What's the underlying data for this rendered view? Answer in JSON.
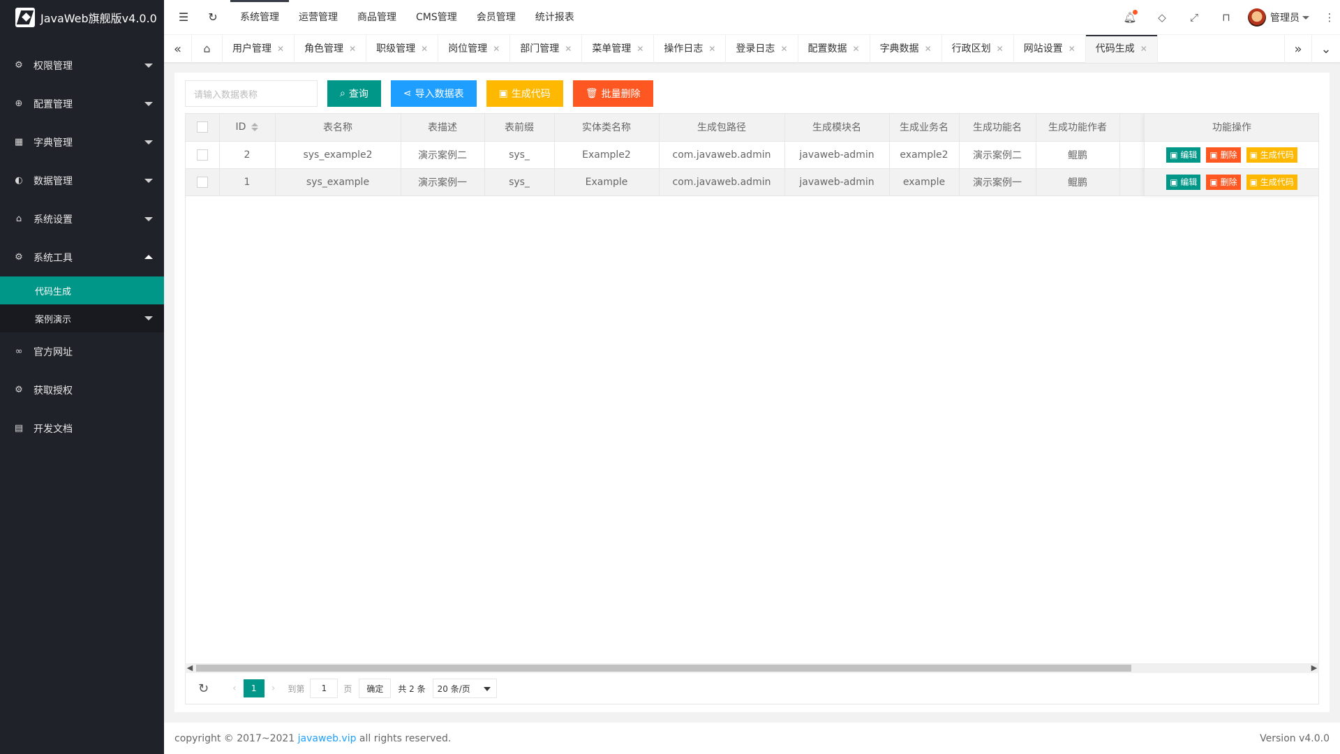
{
  "app": {
    "title": "JavaWeb旗舰版v4.0.0"
  },
  "sidebar": {
    "items": [
      {
        "label": "权限管理",
        "icon": "gear-icon",
        "glyph": "⚙"
      },
      {
        "label": "配置管理",
        "icon": "globe-icon",
        "glyph": "⊕"
      },
      {
        "label": "字典管理",
        "icon": "grid-icon",
        "glyph": "▦"
      },
      {
        "label": "数据管理",
        "icon": "palette-icon",
        "glyph": "◐"
      },
      {
        "label": "系统设置",
        "icon": "home-icon",
        "glyph": "⌂"
      },
      {
        "label": "系统工具",
        "icon": "gear-icon",
        "glyph": "⚙"
      }
    ],
    "submenu": [
      {
        "label": "代码生成"
      },
      {
        "label": "案例演示"
      }
    ],
    "bottom_items": [
      {
        "label": "官方网址",
        "icon": "link-icon",
        "glyph": "∞"
      },
      {
        "label": "获取授权",
        "icon": "gear-icon",
        "glyph": "⚙"
      },
      {
        "label": "开发文档",
        "icon": "book-icon",
        "glyph": "▤"
      }
    ]
  },
  "header": {
    "nav": [
      "系统管理",
      "运营管理",
      "商品管理",
      "CMS管理",
      "会员管理",
      "统计报表"
    ],
    "user": "管理员"
  },
  "tabs": [
    "用户管理",
    "角色管理",
    "职级管理",
    "岗位管理",
    "部门管理",
    "菜单管理",
    "操作日志",
    "登录日志",
    "配置数据",
    "字典数据",
    "行政区划",
    "网站设置",
    "代码生成"
  ],
  "toolbar": {
    "search_placeholder": "请输入数据表称",
    "query": "查询",
    "import": "导入数据表",
    "generate": "生成代码",
    "batch_delete": "批量删除"
  },
  "table": {
    "headers": [
      "ID",
      "表名称",
      "表描述",
      "表前缀",
      "实体类名称",
      "生成包路径",
      "生成模块名",
      "生成业务名",
      "生成功能名",
      "生成功能作者"
    ],
    "ops_header": "功能操作",
    "rows": [
      [
        "2",
        "sys_example2",
        "演示案例二",
        "sys_",
        "Example2",
        "com.javaweb.admin",
        "javaweb-admin",
        "example2",
        "演示案例二",
        "鲲鹏"
      ],
      [
        "1",
        "sys_example",
        "演示案例一",
        "sys_",
        "Example",
        "com.javaweb.admin",
        "javaweb-admin",
        "example",
        "演示案例一",
        "鲲鹏"
      ]
    ],
    "ops": {
      "edit": "编辑",
      "delete": "删除",
      "generate": "生成代码"
    }
  },
  "pager": {
    "current": "1",
    "goto_label": "到第",
    "page_value": "1",
    "page_unit": "页",
    "confirm": "确定",
    "total": "共 2 条",
    "page_size": "20 条/页"
  },
  "footer": {
    "copyright_prefix": "copyright © 2017~2021 ",
    "link": "javaweb.vip",
    "copyright_suffix": " all rights reserved.",
    "version": "Version v4.0.0"
  },
  "colors": {
    "primary": "#009688",
    "blue": "#1e9fff",
    "warm": "#ffb800",
    "danger": "#ff5722",
    "sidebar": "#20222a"
  }
}
